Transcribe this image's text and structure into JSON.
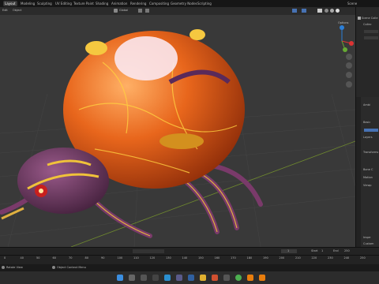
{
  "topbar": {
    "tabs": [
      "Layout",
      "Modeling",
      "Sculpting",
      "UV Editing",
      "Texture Paint",
      "Shading",
      "Animation",
      "Rendering",
      "Compositing",
      "Geometry Nodes",
      "Scripting"
    ],
    "scene_label": "Scene"
  },
  "header": {
    "mode_menu": "Edit",
    "object_menu": "Object",
    "orientation_label": "Global"
  },
  "viewport": {
    "options_label": "Options"
  },
  "outliner": {
    "scene_collection": "Scene Colle",
    "collection": "Collec"
  },
  "properties": {
    "items": [
      "Ambi",
      "Basic",
      "Layers",
      "Transforms",
      "Bone C",
      "Motion",
      "Viewp"
    ],
    "last_items": [
      "Inspe",
      "Custom"
    ]
  },
  "timeline": {
    "ticks": [
      "0",
      "40",
      "50",
      "60",
      "70",
      "80",
      "90",
      "100",
      "110",
      "120",
      "130",
      "140",
      "150",
      "160",
      "170",
      "180",
      "190",
      "200",
      "210",
      "220",
      "230",
      "240",
      "250"
    ],
    "start_label": "Start",
    "end_label": "End",
    "start_value": "1",
    "end_value": "250",
    "current_frame": "1"
  },
  "status": {
    "left": "Rotate View",
    "right": "Object Context Menu"
  },
  "colors": {
    "accent": "#4772b3",
    "body_orange": "#e8661c",
    "legs_purple": "#7a3a6a"
  },
  "taskbar": {
    "icons": [
      "start-icon",
      "search-icon",
      "taskview-icon",
      "files-icon",
      "edge-icon",
      "store-icon",
      "mail-icon",
      "folder-icon",
      "app-icon",
      "chrome-icon",
      "blender-icon",
      "blender2-icon"
    ]
  }
}
